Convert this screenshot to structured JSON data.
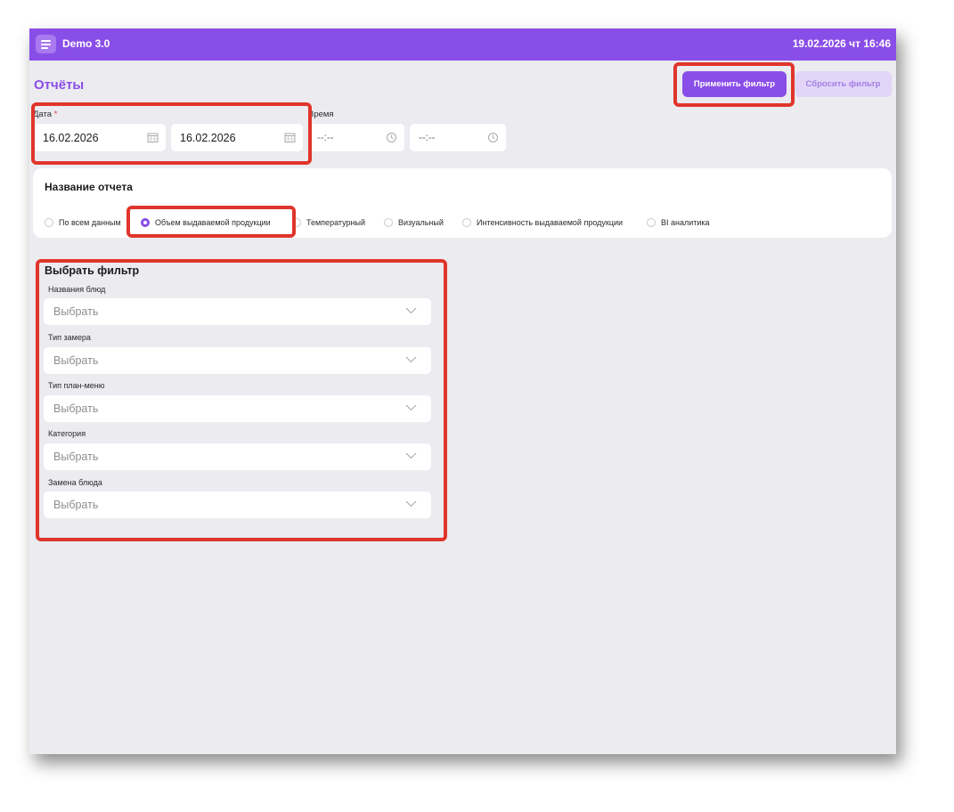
{
  "topbar": {
    "app_title": "Demo 3.0",
    "datetime": "19.02.2026 чт 16:46"
  },
  "page": {
    "title": "Отчёты"
  },
  "toolbar": {
    "apply_label": "Применить фильтр",
    "reset_label": "Сбросить фильтр"
  },
  "date_time": {
    "date_label": "Дата",
    "required_mark": "*",
    "time_label": "Время",
    "date_from": "16.02.2026",
    "date_to": "16.02.2026",
    "time_from": "--:--",
    "time_to": "--:--"
  },
  "report": {
    "title": "Название отчета",
    "options": [
      {
        "label": "По всем данным",
        "selected": false
      },
      {
        "label": "Объем выдаваемой продукции",
        "selected": true
      },
      {
        "label": "Температурный",
        "selected": false
      },
      {
        "label": "Визуальный",
        "selected": false
      },
      {
        "label": "Интенсивность выдаваемой продукции",
        "selected": false
      },
      {
        "label": "BI аналитика",
        "selected": false
      }
    ]
  },
  "filters": {
    "title": "Выбрать фильтр",
    "fields": [
      {
        "label": "Названия блюд",
        "placeholder": "Выбрать"
      },
      {
        "label": "Тип замера",
        "placeholder": "Выбрать"
      },
      {
        "label": "Тип план-меню",
        "placeholder": "Выбрать"
      },
      {
        "label": "Категория",
        "placeholder": "Выбрать"
      },
      {
        "label": "Замена блюда",
        "placeholder": "Выбрать"
      }
    ]
  },
  "colors": {
    "accent": "#8a4ee8",
    "accent_light": "#e2d5f8",
    "background": "#ebebf0",
    "highlight": "#e0352b"
  },
  "icons": {
    "menu": "hamburger-menu-icon",
    "calendar": "calendar-icon",
    "clock": "clock-icon",
    "dropdown": "chevron-down-icon"
  }
}
